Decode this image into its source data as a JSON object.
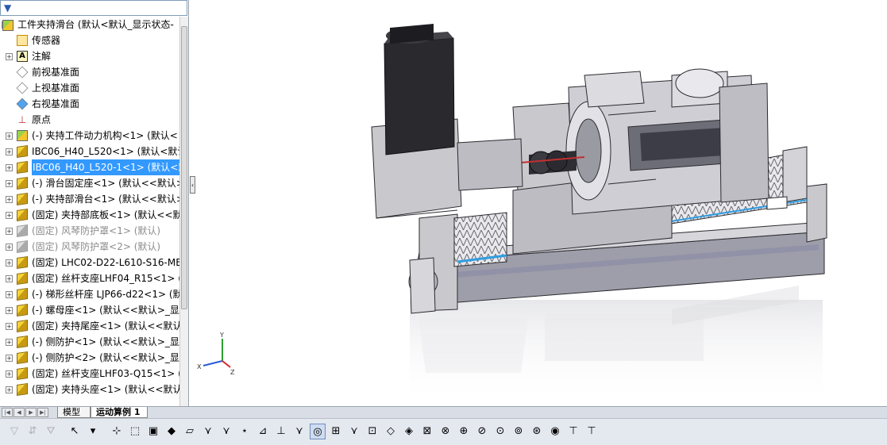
{
  "feature_tree": {
    "root": "工件夹持滑台 (默认<默认_显示状态-",
    "items": [
      {
        "label": "传感器",
        "icon": "sensor-icon"
      },
      {
        "label": "注解",
        "icon": "annotation-icon"
      },
      {
        "label": "前视基准面",
        "icon": "plane-icon"
      },
      {
        "label": "上视基准面",
        "icon": "plane-icon"
      },
      {
        "label": "右视基准面",
        "icon": "plane-icon"
      },
      {
        "label": "原点",
        "icon": "origin-icon"
      },
      {
        "label": "(-) 夹持工件动力机构<1> (默认<",
        "icon": "subassembly-icon"
      },
      {
        "label": "IBC06_H40_L520<1> (默认<默认",
        "icon": "part-icon"
      },
      {
        "label": "IBC06_H40_L520-1<1> (默认<默",
        "icon": "part-icon"
      },
      {
        "label": "(-) 滑台固定座<1> (默认<<默认>",
        "icon": "part-icon"
      },
      {
        "label": "(-) 夹持部滑台<1> (默认<<默认>",
        "icon": "part-icon"
      },
      {
        "label": "(固定) 夹持部底板<1> (默认<<默",
        "icon": "part-icon"
      },
      {
        "label": "(固定) 风琴防护罩<1> (默认)",
        "icon": "part-icon"
      },
      {
        "label": "(固定) 风琴防护罩<2> (默认)",
        "icon": "part-icon"
      },
      {
        "label": "(固定) LHC02-D22-L610-S16-MB",
        "icon": "part-icon"
      },
      {
        "label": "(固定) 丝杆支座LHF04_R15<1> (",
        "icon": "part-icon"
      },
      {
        "label": "(-) 梯形丝杆座 LJP66-d22<1> (默",
        "icon": "part-icon"
      },
      {
        "label": "(-) 螺母座<1> (默认<<默认>_显",
        "icon": "part-icon"
      },
      {
        "label": "(固定) 夹持尾座<1> (默认<<默认",
        "icon": "part-icon"
      },
      {
        "label": "(-) 侧防护<1> (默认<<默认>_显",
        "icon": "part-icon"
      },
      {
        "label": "(-) 侧防护<2> (默认<<默认>_显",
        "icon": "part-icon"
      },
      {
        "label": "(固定) 丝杆支座LHF03-Q15<1> (",
        "icon": "part-icon"
      },
      {
        "label": "(固定) 夹持头座<1> (默认<<默认",
        "icon": "part-icon"
      }
    ]
  },
  "triad": {
    "x": "X",
    "y": "Y",
    "z": "Z"
  },
  "tabs": {
    "model": "模型",
    "motion": "运动算例 1"
  },
  "colors": {
    "selection": "#3399ff",
    "bellows_blue": "#2f9de0",
    "housing_gray": "#c9c8cd"
  }
}
